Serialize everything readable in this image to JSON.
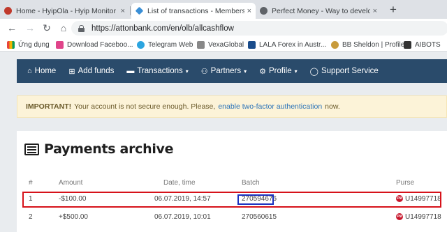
{
  "browser": {
    "tabs": [
      {
        "title": "Home - HyipOla - Hyip Monitor | ",
        "close": "×",
        "active": false,
        "color": "#c0392b"
      },
      {
        "title": "List of transactions - Members ar",
        "close": "×",
        "active": true,
        "color": "#3b8fd6"
      },
      {
        "title": "Perfect Money - Way to develop",
        "close": "×",
        "active": false,
        "color": "#5f6368"
      }
    ],
    "new_tab": "+",
    "url": "https://attonbank.com/en/olb/allcashflow",
    "bookmarks": [
      {
        "label": "Ứng dụng",
        "color": "#e8453c"
      },
      {
        "label": "Download Faceboo...",
        "color": "#e0448a"
      },
      {
        "label": "Telegram Web",
        "color": "#2ca5e0"
      },
      {
        "label": "VexaGlobal",
        "color": "#888888"
      },
      {
        "label": "LALA Forex in Austr...",
        "color": "#1a4c8b"
      },
      {
        "label": "BB Sheldon | Profile",
        "color": "#c89b3c"
      },
      {
        "label": "AIBOTS",
        "color": "#333333"
      }
    ]
  },
  "nav": {
    "items": [
      {
        "label": "Home",
        "icon": "home-icon",
        "glyph": "⌂"
      },
      {
        "label": "Add funds",
        "icon": "plus-box-icon",
        "glyph": "⊞"
      },
      {
        "label": "Transactions",
        "icon": "card-icon",
        "glyph": "▬",
        "caret": "▾"
      },
      {
        "label": "Partners",
        "icon": "users-icon",
        "glyph": "⚇",
        "caret": "▾"
      },
      {
        "label": "Profile",
        "icon": "gear-icon",
        "glyph": "⚙",
        "caret": "▾"
      },
      {
        "label": "Support Service",
        "icon": "chat-icon",
        "glyph": "◯"
      }
    ]
  },
  "alert": {
    "strong": "IMPORTANT!",
    "text": "Your account is not secure enough. Please,",
    "link": "enable two-factor authentication",
    "tail": "now."
  },
  "archive": {
    "title": "Payments archive",
    "headers": {
      "num": "#",
      "amount": "Amount",
      "date": "Date, time",
      "batch": "Batch",
      "purse": "Purse"
    },
    "rows": [
      {
        "num": "1",
        "amount": "-$100.00",
        "date": "06.07.2019, 14:57",
        "batch": "270594676",
        "purse_icon": "PM",
        "purse": "U14997718"
      },
      {
        "num": "2",
        "amount": "+$500.00",
        "date": "06.07.2019, 10:01",
        "batch": "270560615",
        "purse_icon": "PM",
        "purse": "U14997718"
      }
    ]
  },
  "colors": {
    "navbar": "#2a4b6b",
    "alert_bg": "#fcf3d8",
    "highlight_row": "#d6121a",
    "highlight_batch": "#1a2fbf",
    "link": "#2b73b8"
  }
}
